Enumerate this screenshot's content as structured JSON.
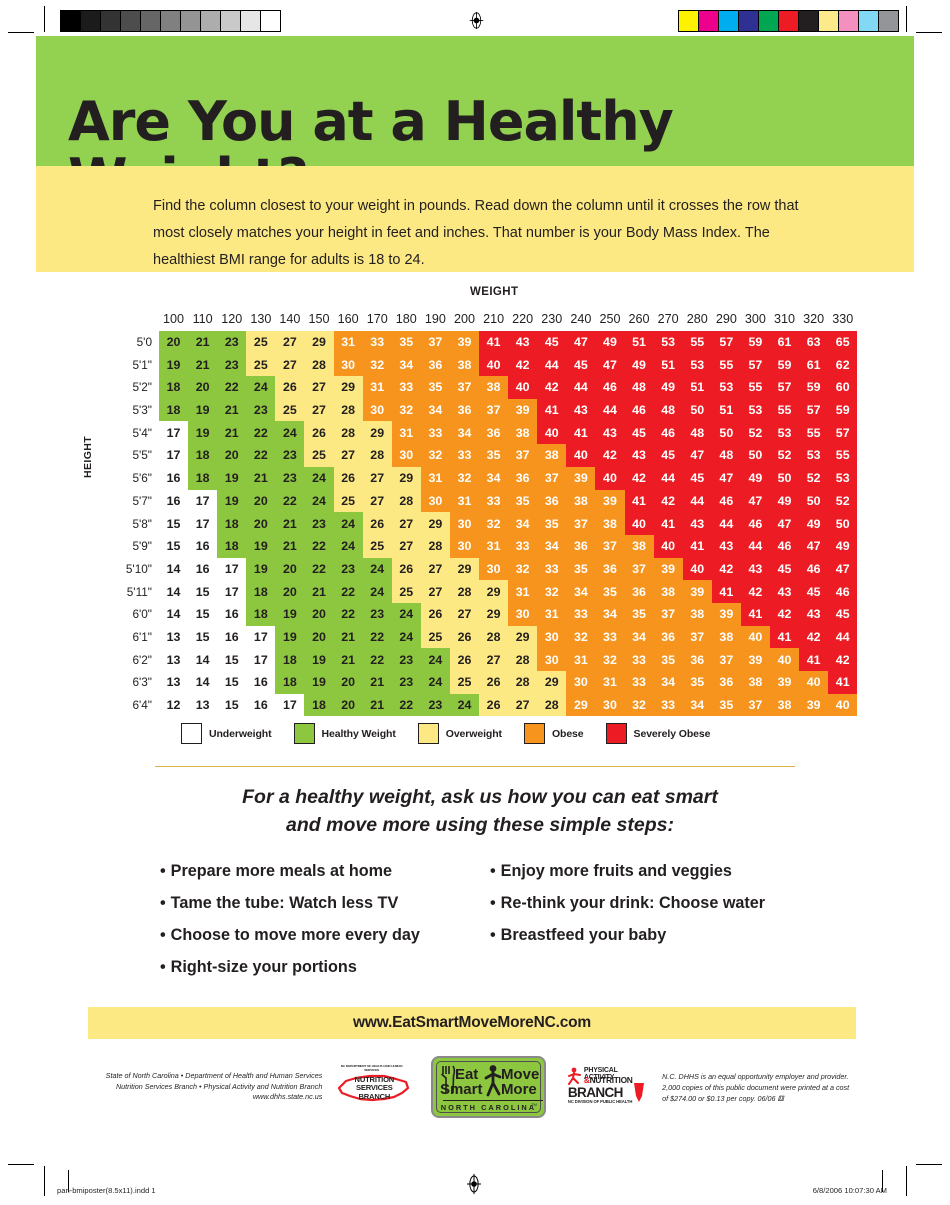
{
  "header": {
    "title": "Are You at a Healthy Weight?",
    "intro": "Find the column closest to your weight in pounds. Read down the column until it crosses the row that most closely matches your height in feet and inches. That number is your Body Mass Index. The healthiest BMI range for adults is 18 to 24."
  },
  "axis": {
    "weight_label": "WEIGHT",
    "height_label": "HEIGHT"
  },
  "colors": {
    "band_green": "#93d150",
    "band_yellow": "#fce983",
    "cell_underweight": "#ffffff",
    "cell_healthy": "#8dc63f",
    "cell_overweight": "#fce983",
    "cell_obese": "#f7941e",
    "cell_severely_obese": "#ed1c24",
    "text_dark": "#231f20"
  },
  "legend": [
    {
      "label": "Underweight",
      "color": "#ffffff",
      "key": "under"
    },
    {
      "label": "Healthy Weight",
      "color": "#8dc63f",
      "key": "healthy"
    },
    {
      "label": "Overweight",
      "color": "#fce983",
      "key": "over"
    },
    {
      "label": "Obese",
      "color": "#f7941e",
      "key": "obese"
    },
    {
      "label": "Severely Obese",
      "color": "#ed1c24",
      "key": "severe"
    }
  ],
  "chart_data": {
    "type": "heatmap",
    "title": "Are You at a Healthy Weight?",
    "xlabel": "WEIGHT",
    "ylabel": "HEIGHT",
    "categories": [
      "100",
      "110",
      "120",
      "130",
      "140",
      "150",
      "160",
      "170",
      "180",
      "190",
      "200",
      "210",
      "220",
      "230",
      "240",
      "250",
      "260",
      "270",
      "280",
      "290",
      "300",
      "310",
      "320",
      "330"
    ],
    "rows": [
      "5'0",
      "5'1\"",
      "5'2\"",
      "5'3\"",
      "5'4\"",
      "5'5\"",
      "5'6\"",
      "5'7\"",
      "5'8\"",
      "5'9\"",
      "5'10\"",
      "5'11\"",
      "6'0\"",
      "6'1\"",
      "6'2\"",
      "6'3\"",
      "6'4\""
    ],
    "values": [
      [
        20,
        21,
        23,
        25,
        27,
        29,
        31,
        33,
        35,
        37,
        39,
        41,
        43,
        45,
        47,
        49,
        51,
        53,
        55,
        57,
        59,
        61,
        63,
        65
      ],
      [
        19,
        21,
        23,
        25,
        27,
        28,
        30,
        32,
        34,
        36,
        38,
        40,
        42,
        44,
        45,
        47,
        49,
        51,
        53,
        55,
        57,
        59,
        61,
        62
      ],
      [
        18,
        20,
        22,
        24,
        26,
        27,
        29,
        31,
        33,
        35,
        37,
        38,
        40,
        42,
        44,
        46,
        48,
        49,
        51,
        53,
        55,
        57,
        59,
        60
      ],
      [
        18,
        19,
        21,
        23,
        25,
        27,
        28,
        30,
        32,
        34,
        36,
        37,
        39,
        41,
        43,
        44,
        46,
        48,
        50,
        51,
        53,
        55,
        57,
        59
      ],
      [
        17,
        19,
        21,
        22,
        24,
        26,
        28,
        29,
        31,
        33,
        34,
        36,
        38,
        40,
        41,
        43,
        45,
        46,
        48,
        50,
        52,
        53,
        55,
        57
      ],
      [
        17,
        18,
        20,
        22,
        23,
        25,
        27,
        28,
        30,
        32,
        33,
        35,
        37,
        38,
        40,
        42,
        43,
        45,
        47,
        48,
        50,
        52,
        53,
        55
      ],
      [
        16,
        18,
        19,
        21,
        23,
        24,
        26,
        27,
        29,
        31,
        32,
        34,
        36,
        37,
        39,
        40,
        42,
        44,
        45,
        47,
        49,
        50,
        52,
        53
      ],
      [
        16,
        17,
        19,
        20,
        22,
        24,
        25,
        27,
        28,
        30,
        31,
        33,
        35,
        36,
        38,
        39,
        41,
        42,
        44,
        46,
        47,
        49,
        50,
        52
      ],
      [
        15,
        17,
        18,
        20,
        21,
        23,
        24,
        26,
        27,
        29,
        30,
        32,
        34,
        35,
        37,
        38,
        40,
        41,
        43,
        44,
        46,
        47,
        49,
        50
      ],
      [
        15,
        16,
        18,
        19,
        21,
        22,
        24,
        25,
        27,
        28,
        30,
        31,
        33,
        34,
        36,
        37,
        38,
        40,
        41,
        43,
        44,
        46,
        47,
        49
      ],
      [
        14,
        16,
        17,
        19,
        20,
        22,
        23,
        24,
        26,
        27,
        29,
        30,
        32,
        33,
        35,
        36,
        37,
        39,
        40,
        42,
        43,
        45,
        46,
        47
      ],
      [
        14,
        15,
        17,
        18,
        20,
        21,
        22,
        24,
        25,
        27,
        28,
        29,
        31,
        32,
        34,
        35,
        36,
        38,
        39,
        41,
        42,
        43,
        45,
        46
      ],
      [
        14,
        15,
        16,
        18,
        19,
        20,
        22,
        23,
        24,
        26,
        27,
        29,
        30,
        31,
        33,
        34,
        35,
        37,
        38,
        39,
        41,
        42,
        43,
        45
      ],
      [
        13,
        15,
        16,
        17,
        19,
        20,
        21,
        22,
        24,
        25,
        26,
        28,
        29,
        30,
        32,
        33,
        34,
        36,
        37,
        38,
        40,
        41,
        42,
        44
      ],
      [
        13,
        14,
        15,
        17,
        18,
        19,
        21,
        22,
        23,
        24,
        26,
        27,
        28,
        30,
        31,
        32,
        33,
        35,
        36,
        37,
        39,
        40,
        41,
        42
      ],
      [
        13,
        14,
        15,
        16,
        18,
        19,
        20,
        21,
        23,
        24,
        25,
        26,
        28,
        29,
        30,
        31,
        33,
        34,
        35,
        36,
        38,
        39,
        40,
        41
      ],
      [
        12,
        13,
        15,
        16,
        17,
        18,
        20,
        21,
        22,
        23,
        24,
        26,
        27,
        28,
        29,
        30,
        32,
        33,
        34,
        35,
        37,
        38,
        39,
        40
      ]
    ],
    "categories_by_cell": [
      [
        "healthy",
        "healthy",
        "healthy",
        "over",
        "over",
        "over",
        "obese",
        "obese",
        "obese",
        "obese",
        "obese",
        "severe",
        "severe",
        "severe",
        "severe",
        "severe",
        "severe",
        "severe",
        "severe",
        "severe",
        "severe",
        "severe",
        "severe",
        "severe"
      ],
      [
        "healthy",
        "healthy",
        "healthy",
        "over",
        "over",
        "over",
        "obese",
        "obese",
        "obese",
        "obese",
        "obese",
        "severe",
        "severe",
        "severe",
        "severe",
        "severe",
        "severe",
        "severe",
        "severe",
        "severe",
        "severe",
        "severe",
        "severe",
        "severe"
      ],
      [
        "healthy",
        "healthy",
        "healthy",
        "healthy",
        "over",
        "over",
        "over",
        "obese",
        "obese",
        "obese",
        "obese",
        "obese",
        "severe",
        "severe",
        "severe",
        "severe",
        "severe",
        "severe",
        "severe",
        "severe",
        "severe",
        "severe",
        "severe",
        "severe"
      ],
      [
        "healthy",
        "healthy",
        "healthy",
        "healthy",
        "over",
        "over",
        "over",
        "obese",
        "obese",
        "obese",
        "obese",
        "obese",
        "obese",
        "severe",
        "severe",
        "severe",
        "severe",
        "severe",
        "severe",
        "severe",
        "severe",
        "severe",
        "severe",
        "severe"
      ],
      [
        "under",
        "healthy",
        "healthy",
        "healthy",
        "healthy",
        "over",
        "over",
        "over",
        "obese",
        "obese",
        "obese",
        "obese",
        "obese",
        "severe",
        "severe",
        "severe",
        "severe",
        "severe",
        "severe",
        "severe",
        "severe",
        "severe",
        "severe",
        "severe"
      ],
      [
        "under",
        "healthy",
        "healthy",
        "healthy",
        "healthy",
        "over",
        "over",
        "over",
        "obese",
        "obese",
        "obese",
        "obese",
        "obese",
        "obese",
        "severe",
        "severe",
        "severe",
        "severe",
        "severe",
        "severe",
        "severe",
        "severe",
        "severe",
        "severe"
      ],
      [
        "under",
        "healthy",
        "healthy",
        "healthy",
        "healthy",
        "healthy",
        "over",
        "over",
        "over",
        "obese",
        "obese",
        "obese",
        "obese",
        "obese",
        "obese",
        "severe",
        "severe",
        "severe",
        "severe",
        "severe",
        "severe",
        "severe",
        "severe",
        "severe"
      ],
      [
        "under",
        "under",
        "healthy",
        "healthy",
        "healthy",
        "healthy",
        "over",
        "over",
        "over",
        "obese",
        "obese",
        "obese",
        "obese",
        "obese",
        "obese",
        "obese",
        "severe",
        "severe",
        "severe",
        "severe",
        "severe",
        "severe",
        "severe",
        "severe"
      ],
      [
        "under",
        "under",
        "healthy",
        "healthy",
        "healthy",
        "healthy",
        "healthy",
        "over",
        "over",
        "over",
        "obese",
        "obese",
        "obese",
        "obese",
        "obese",
        "obese",
        "severe",
        "severe",
        "severe",
        "severe",
        "severe",
        "severe",
        "severe",
        "severe"
      ],
      [
        "under",
        "under",
        "healthy",
        "healthy",
        "healthy",
        "healthy",
        "healthy",
        "over",
        "over",
        "over",
        "obese",
        "obese",
        "obese",
        "obese",
        "obese",
        "obese",
        "obese",
        "severe",
        "severe",
        "severe",
        "severe",
        "severe",
        "severe",
        "severe"
      ],
      [
        "under",
        "under",
        "under",
        "healthy",
        "healthy",
        "healthy",
        "healthy",
        "healthy",
        "over",
        "over",
        "over",
        "obese",
        "obese",
        "obese",
        "obese",
        "obese",
        "obese",
        "obese",
        "severe",
        "severe",
        "severe",
        "severe",
        "severe",
        "severe"
      ],
      [
        "under",
        "under",
        "under",
        "healthy",
        "healthy",
        "healthy",
        "healthy",
        "healthy",
        "over",
        "over",
        "over",
        "over",
        "obese",
        "obese",
        "obese",
        "obese",
        "obese",
        "obese",
        "obese",
        "severe",
        "severe",
        "severe",
        "severe",
        "severe"
      ],
      [
        "under",
        "under",
        "under",
        "healthy",
        "healthy",
        "healthy",
        "healthy",
        "healthy",
        "healthy",
        "over",
        "over",
        "over",
        "obese",
        "obese",
        "obese",
        "obese",
        "obese",
        "obese",
        "obese",
        "obese",
        "severe",
        "severe",
        "severe",
        "severe"
      ],
      [
        "under",
        "under",
        "under",
        "under",
        "healthy",
        "healthy",
        "healthy",
        "healthy",
        "healthy",
        "over",
        "over",
        "over",
        "over",
        "obese",
        "obese",
        "obese",
        "obese",
        "obese",
        "obese",
        "obese",
        "obese",
        "severe",
        "severe",
        "severe"
      ],
      [
        "under",
        "under",
        "under",
        "under",
        "healthy",
        "healthy",
        "healthy",
        "healthy",
        "healthy",
        "healthy",
        "over",
        "over",
        "over",
        "obese",
        "obese",
        "obese",
        "obese",
        "obese",
        "obese",
        "obese",
        "obese",
        "obese",
        "severe",
        "severe"
      ],
      [
        "under",
        "under",
        "under",
        "under",
        "healthy",
        "healthy",
        "healthy",
        "healthy",
        "healthy",
        "healthy",
        "over",
        "over",
        "over",
        "over",
        "obese",
        "obese",
        "obese",
        "obese",
        "obese",
        "obese",
        "obese",
        "obese",
        "obese",
        "severe"
      ],
      [
        "under",
        "under",
        "under",
        "under",
        "under",
        "healthy",
        "healthy",
        "healthy",
        "healthy",
        "healthy",
        "healthy",
        "over",
        "over",
        "over",
        "obese",
        "obese",
        "obese",
        "obese",
        "obese",
        "obese",
        "obese",
        "obese",
        "obese",
        "obese"
      ]
    ]
  },
  "steps": {
    "heading": "For a healthy weight, ask us how you can eat smart and move more using these simple steps:",
    "heading_line1": "For a healthy weight, ask us how you can eat smart",
    "heading_line2": "and move more using these simple steps:",
    "left": [
      "Prepare more meals at home",
      "Tame the tube: Watch less TV",
      "Choose to move more every day",
      "Right-size your portions"
    ],
    "right": [
      "Enjoy more fruits and veggies",
      "Re-think your drink: Choose water",
      "Breastfeed your baby"
    ],
    "bullet": "•"
  },
  "url_banner": {
    "text": "www.EatSmartMoveMoreNC.com"
  },
  "footer": {
    "agency_line1": "State of North Carolina • Department of Health and Human Services",
    "agency_line2": "Nutrition Services Branch • Physical Activity and Nutrition Branch",
    "agency_line3": "www.dhhs.state.nc.us",
    "nsb_logo": {
      "top": "NC DEPARTMENT OF HEALTH AND HUMAN SERVICES",
      "line1": "NUTRITION",
      "line2": "SERVICES",
      "line3": "BRANCH"
    },
    "esmm_logo": {
      "eat": "Eat",
      "smart": "Smart",
      "move": "Move",
      "more": "More",
      "state": "NORTH CAROLINA",
      "tm": "TM"
    },
    "pan_logo": {
      "line1": "PHYSICAL ACTIVITY",
      "amp": "&",
      "line2": "NUTRITION",
      "line3": "BRANCH",
      "line4": "NC DIVISION OF PUBLIC HEALTH"
    },
    "disclaimer_line1": "N.C. DHHS is an equal opportunity employer and provider.",
    "disclaimer_line2": "2,000 copies of this public document were printed at a cost",
    "disclaimer_line3": "of $274.00 or $0.13 per copy. 06/06"
  },
  "print_marks": {
    "file_name": "pan-bmiposter(8.5x11).indd   1",
    "timestamp": "6/8/2006   10:07:30 AM",
    "gray_swatches": [
      "#000000",
      "#1b1b1b",
      "#333333",
      "#4d4d4d",
      "#666666",
      "#808080",
      "#949494",
      "#adadad",
      "#c9c9c9",
      "#e6e6e6",
      "#ffffff"
    ],
    "color_swatches": [
      "#fff200",
      "#ec008c",
      "#00aeef",
      "#2e3192",
      "#00a651",
      "#ed1c24",
      "#231f20",
      "#fdea8b",
      "#f490c0",
      "#82d9f5",
      "#939598"
    ]
  }
}
